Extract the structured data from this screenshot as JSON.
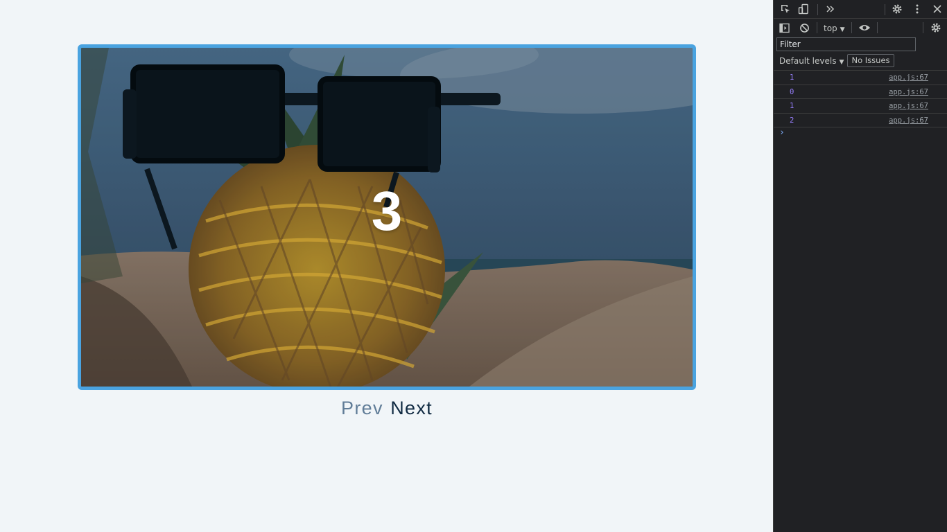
{
  "slider": {
    "current_number": "3",
    "prev_label": "Prev",
    "next_label": "Next",
    "border_color": "#4aa3e0",
    "image": "pineapple-with-sunglasses-on-beach"
  },
  "devtools": {
    "context_label": "top",
    "filter_placeholder": "Filter",
    "levels_label": "Default levels",
    "issues_label": "No Issues",
    "icons": [
      "inspect-element-icon",
      "device-toolbar-icon",
      "more-tabs-icon",
      "settings-icon",
      "kebab-menu-icon",
      "close-icon",
      "sidebar-toggle-icon",
      "clear-console-icon",
      "live-expression-icon",
      "console-settings-icon"
    ],
    "logs": [
      {
        "value": "1",
        "source": "app.js:67"
      },
      {
        "value": "0",
        "source": "app.js:67"
      },
      {
        "value": "1",
        "source": "app.js:67"
      },
      {
        "value": "2",
        "source": "app.js:67"
      }
    ]
  }
}
